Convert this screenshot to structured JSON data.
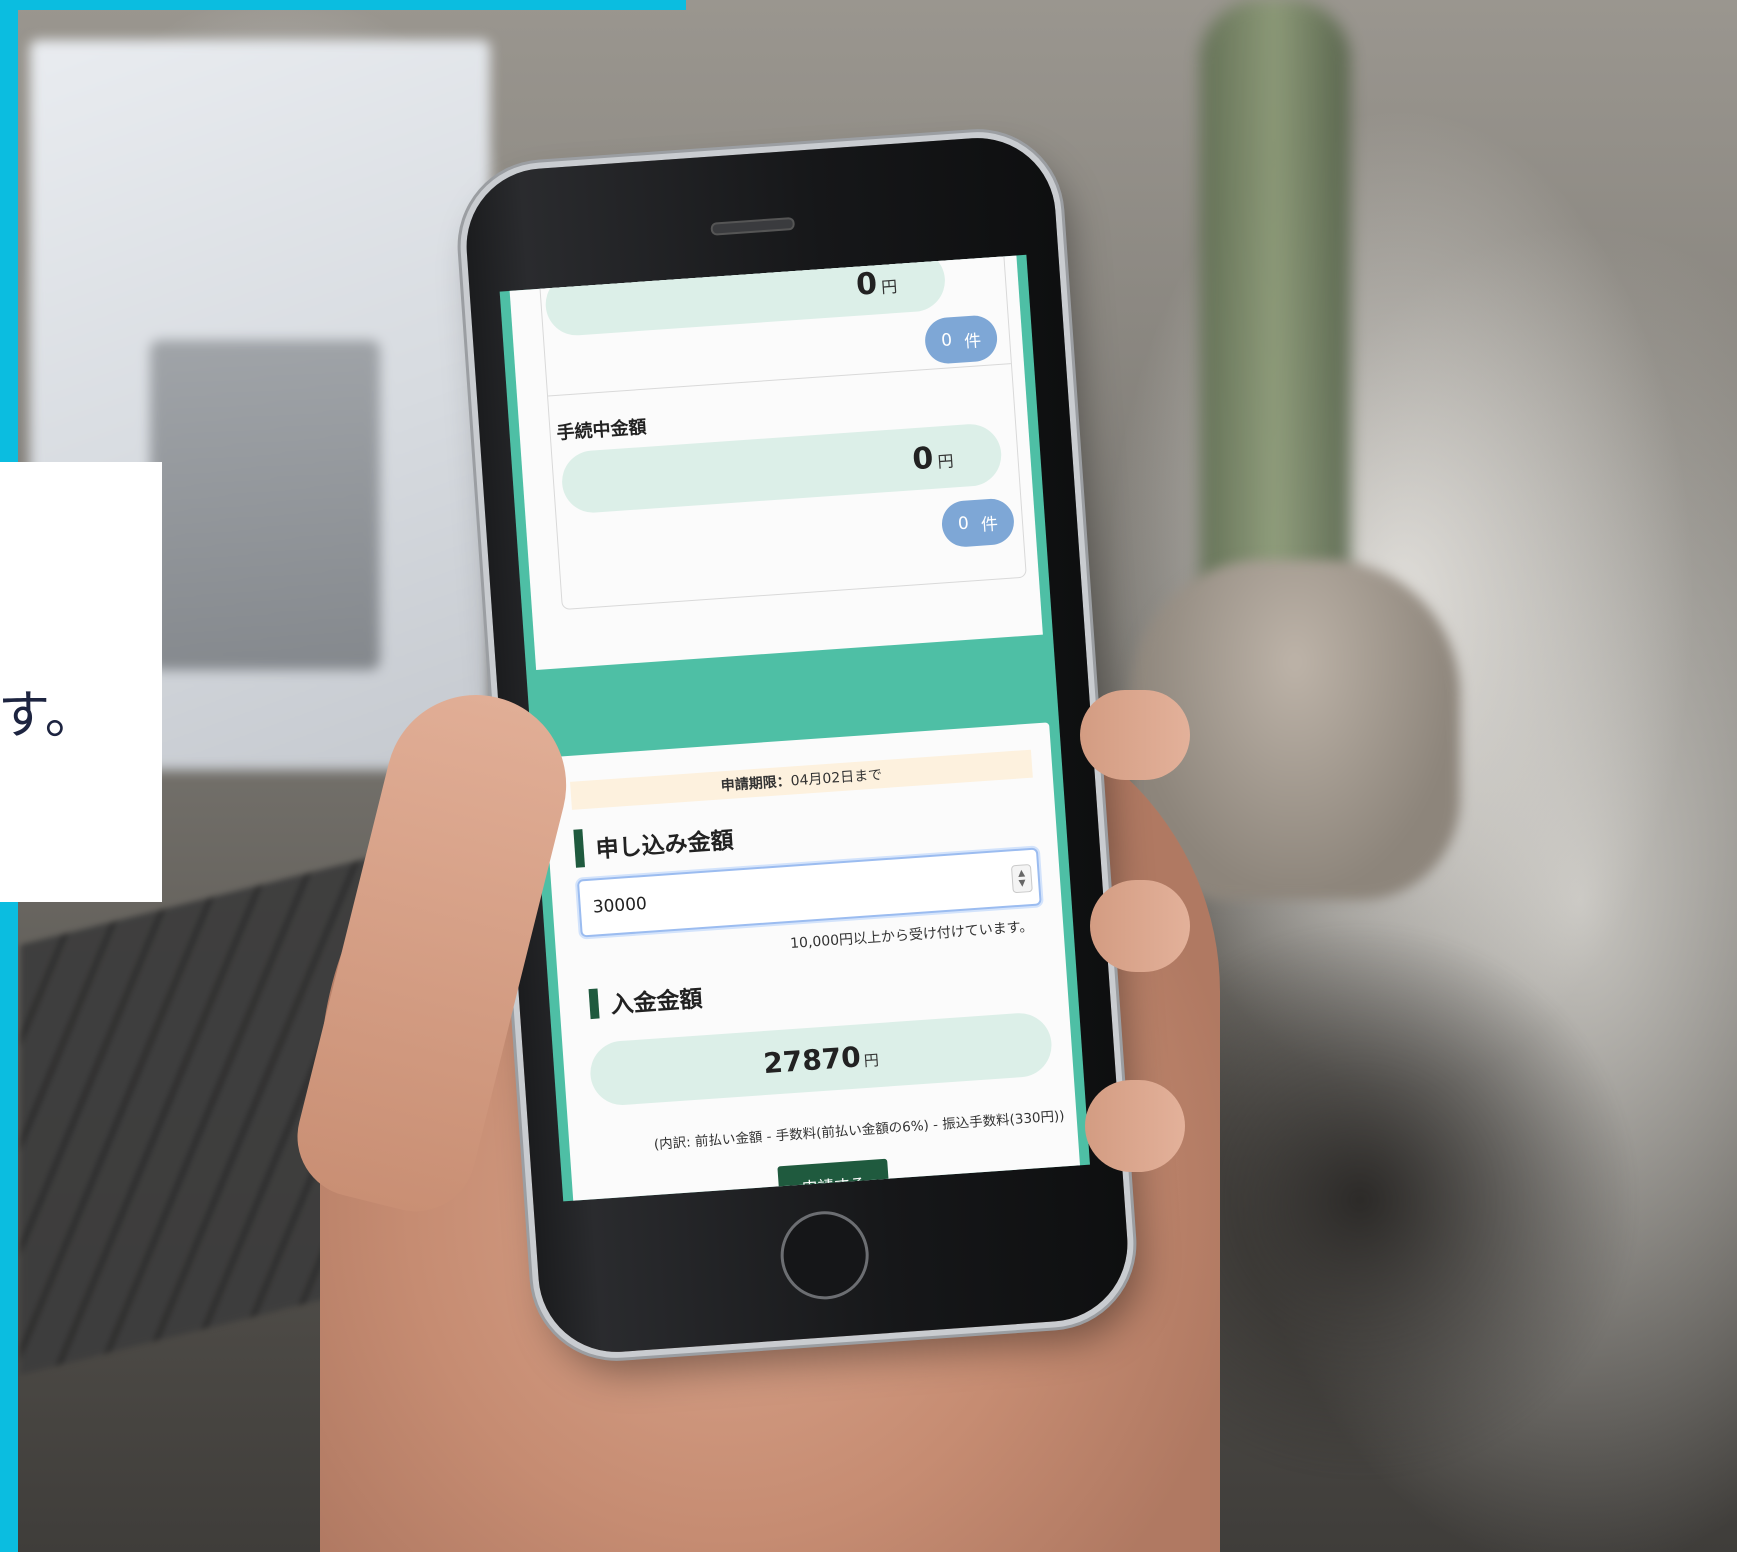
{
  "decor": {
    "card_text": "す。"
  },
  "summary": {
    "top_amount": "0",
    "top_unit": "円",
    "top_count": "0",
    "top_count_unit": "件",
    "processing_label": "手続中金額",
    "processing_amount": "0",
    "processing_unit": "円",
    "processing_count": "0",
    "processing_count_unit": "件"
  },
  "application": {
    "deadline_label": "申請期限：",
    "deadline_value": "04月02日まで",
    "amount_heading": "申し込み金額",
    "amount_value": "30000",
    "amount_hint": "10,000円以上から受け付けています。",
    "deposit_heading": "入金金額",
    "deposit_amount": "27870",
    "deposit_unit": "円",
    "breakdown": "(内訳: 前払い金額 - 手数料(前払い金額の6%) - 振込手数料(330円))",
    "submit_label": "申請する"
  },
  "colors": {
    "accent_cyan": "#0bbde0",
    "screen_green": "#4ebfa5",
    "dark_green": "#1f5a3e",
    "pill_mint": "#dcefe8",
    "badge_blue": "#7ea7d6"
  }
}
